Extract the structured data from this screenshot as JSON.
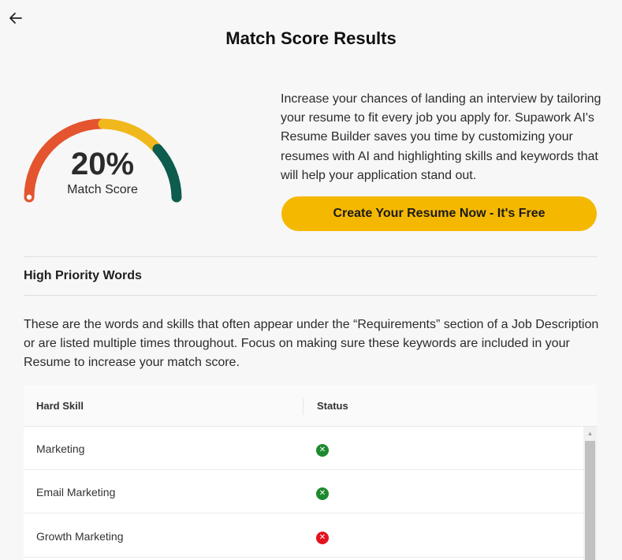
{
  "header": {
    "title": "Match Score Results",
    "back_icon": "arrow-left-icon"
  },
  "gauge": {
    "percent_text": "20%",
    "label": "Match Score",
    "value_fraction": 0.2,
    "colors": {
      "red": "#e4542f",
      "yellow": "#f0b81c",
      "green": "#0d5c4d",
      "marker": "#e4542f"
    }
  },
  "promo": {
    "text": "Increase your chances of landing an interview by tailoring your resume to fit every job you apply for. Supawork AI's Resume Builder saves you time by customizing your resumes with AI and highlighting skills and keywords that will help your application stand out.",
    "cta_label": "Create Your Resume Now - It's Free",
    "cta_color": "#f5b800"
  },
  "high_priority": {
    "title": "High Priority Words",
    "description": "These are the words and skills that often appear under the “Requirements” section of a Job Description or are listed multiple times throughout. Focus on making sure these keywords are included in your Resume to increase your match score."
  },
  "table": {
    "columns": [
      "Hard Skill",
      "Status"
    ],
    "rows": [
      {
        "skill": "Marketing",
        "status": "missing",
        "icon": "x-circle-icon",
        "color": "#1e8a2e",
        "glyph": "✕"
      },
      {
        "skill": "Email Marketing",
        "status": "missing",
        "icon": "x-circle-icon",
        "color": "#1e8a2e",
        "glyph": "✕"
      },
      {
        "skill": "Growth Marketing",
        "status": "missing",
        "icon": "x-circle-icon",
        "color": "#e3121f",
        "glyph": "✕"
      }
    ],
    "scroll_up_glyph": "▲"
  }
}
